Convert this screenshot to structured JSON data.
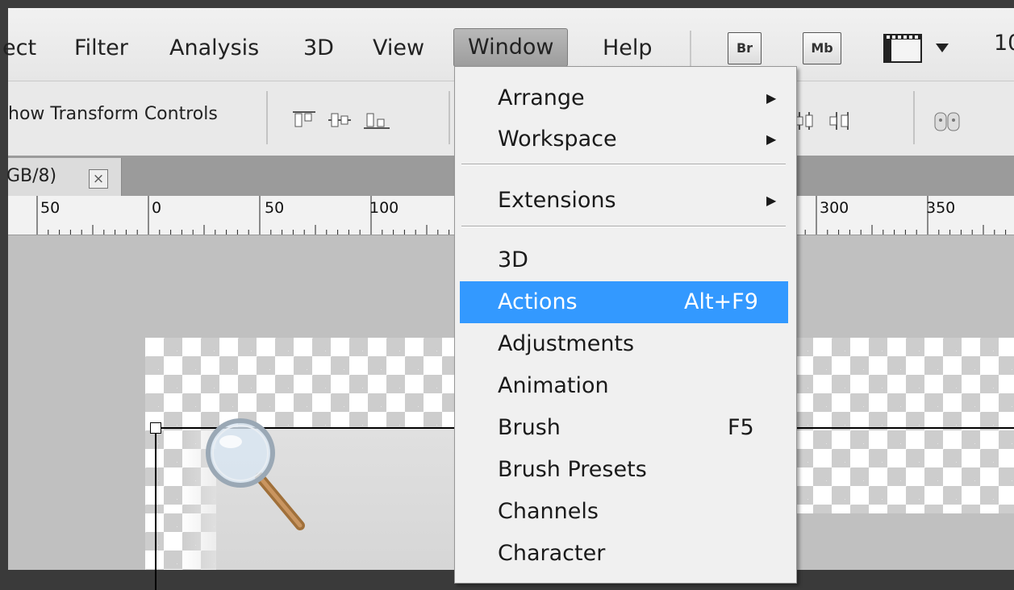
{
  "menubar": {
    "items": [
      "ect",
      "Filter",
      "Analysis",
      "3D",
      "View",
      "Window",
      "Help"
    ],
    "active": "Window",
    "app_buttons": [
      "Br",
      "Mb"
    ],
    "zoom_partial": "10"
  },
  "options_bar": {
    "transform_controls_label": "how Transform Controls"
  },
  "document": {
    "tab_label": "GB/8)",
    "close_glyph": "×"
  },
  "ruler": {
    "labels": [
      "50",
      "0",
      "50",
      "100",
      "300",
      "350"
    ]
  },
  "window_menu": {
    "items": [
      {
        "label": "Arrange",
        "submenu": true
      },
      {
        "label": "Workspace",
        "submenu": true
      },
      {
        "label": "Extensions",
        "submenu": true
      },
      {
        "label": "3D"
      },
      {
        "label": "Actions",
        "shortcut": "Alt+F9",
        "highlighted": true
      },
      {
        "label": "Adjustments"
      },
      {
        "label": "Animation"
      },
      {
        "label": "Brush",
        "shortcut": "F5"
      },
      {
        "label": "Brush Presets"
      },
      {
        "label": "Channels"
      },
      {
        "label": "Character"
      }
    ],
    "submenu_glyph": "▶",
    "highlight_color": "#3399ff"
  }
}
